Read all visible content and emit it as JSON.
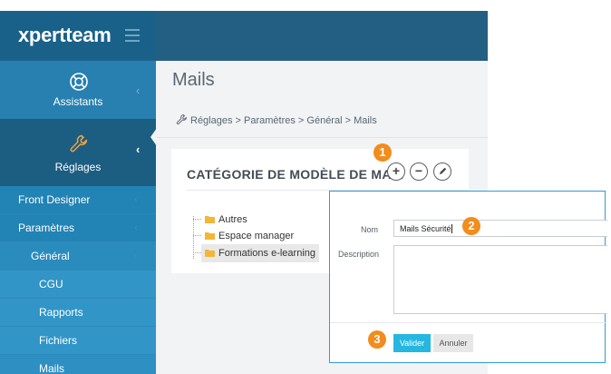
{
  "brand": {
    "logo": "xpertteam"
  },
  "sidebar": {
    "assistants_label": "Assistants",
    "reglages_label": "Réglages",
    "items": [
      {
        "label": "Front Designer"
      },
      {
        "label": "Paramètres"
      },
      {
        "label": "Général"
      },
      {
        "label": "CGU"
      },
      {
        "label": "Rapports"
      },
      {
        "label": "Fichiers"
      },
      {
        "label": "Mails"
      }
    ]
  },
  "page": {
    "title": "Mails",
    "breadcrumb": "Réglages > Paramètres > Général > Mails"
  },
  "card": {
    "title": "CATÉGORIE DE MODÈLE DE MAIL",
    "add_glyph": "+",
    "remove_glyph": "−",
    "tree": [
      {
        "label": "Autres"
      },
      {
        "label": "Espace manager"
      },
      {
        "label": "Formations e-learning"
      }
    ]
  },
  "modal": {
    "nom_label": "Nom",
    "nom_value": "Mails Sécurité",
    "description_label": "Description",
    "valider_label": "Valider",
    "annuler_label": "Annuler"
  },
  "badges": {
    "one": "1",
    "two": "2",
    "three": "3"
  },
  "colors": {
    "sidebar": "#1e6f9a",
    "topbar": "#225f82",
    "badge": "#f28c1c",
    "primary_button": "#26b7e0",
    "modal_border": "#2f9bd6"
  },
  "icons": [
    "lifebuoy-icon",
    "wrench-icon",
    "hamburger-icon",
    "chevron-left-icon",
    "folder-icon",
    "plus-icon",
    "minus-icon",
    "pencil-icon"
  ]
}
